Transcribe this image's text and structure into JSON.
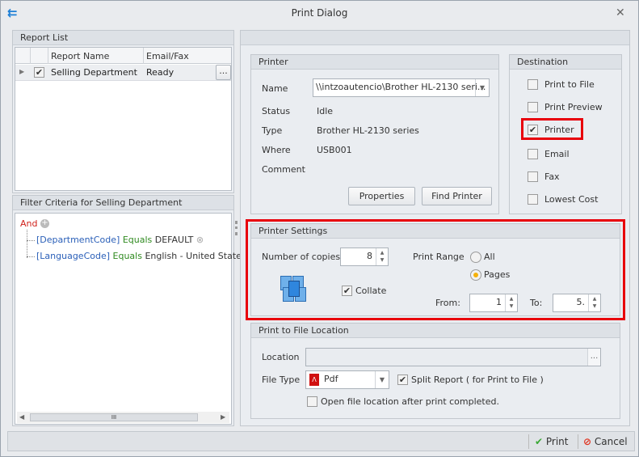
{
  "window": {
    "title": "Print Dialog",
    "close_icon": "close-icon"
  },
  "report_list": {
    "title": "Report List",
    "columns": [
      "Report Name",
      "Email/Fax"
    ],
    "rows": [
      {
        "checked": true,
        "name": "Selling Department",
        "email_fax": "Ready",
        "button": "..."
      }
    ]
  },
  "filter": {
    "title": "Filter Criteria for Selling Department",
    "root": "And",
    "conditions": [
      {
        "field": "[DepartmentCode]",
        "op": "Equals",
        "value": "DEFAULT"
      },
      {
        "field": "[LanguageCode]",
        "op": "Equals",
        "value": "English - United States"
      }
    ],
    "scroll_grip": "III"
  },
  "printer": {
    "title": "Printer",
    "name_label": "Name",
    "name_value": "\\\\intzoautencio\\Brother HL-2130 seri...",
    "status_label": "Status",
    "status_value": "Idle",
    "type_label": "Type",
    "type_value": "Brother HL-2130 series",
    "where_label": "Where",
    "where_value": "USB001",
    "comment_label": "Comment",
    "properties_button": "Properties",
    "find_button": "Find Printer"
  },
  "destination": {
    "title": "Destination",
    "options": [
      {
        "label": "Print to File",
        "checked": false
      },
      {
        "label": "Print Preview",
        "checked": false
      },
      {
        "label": "Printer",
        "checked": true
      },
      {
        "label": "Email",
        "checked": false
      },
      {
        "label": "Fax",
        "checked": false
      },
      {
        "label": "Lowest Cost",
        "checked": false
      }
    ]
  },
  "settings": {
    "title": "Printer Settings",
    "copies_label": "Number of copies",
    "copies": "8",
    "collate_label": "Collate",
    "collate": true,
    "range_label": "Print Range",
    "range_all": "All",
    "range_pages": "Pages",
    "range_selected": "Pages",
    "from_label": "From:",
    "from": "1",
    "to_label": "To:",
    "to": "5."
  },
  "file": {
    "title": "Print to File Location",
    "location_label": "Location",
    "location_value": "",
    "browse": "...",
    "filetype_label": "File Type",
    "filetype": "Pdf",
    "split_label": "Split Report ( for Print to File )",
    "split": true,
    "open_label": "Open file location after print completed.",
    "open": false
  },
  "footer": {
    "print": "Print",
    "cancel": "Cancel"
  }
}
